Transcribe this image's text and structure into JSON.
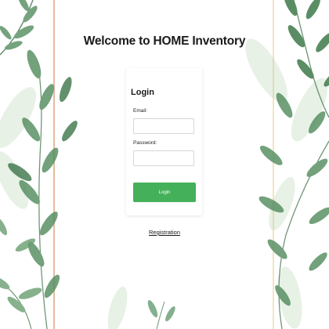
{
  "page": {
    "title": "Welcome to HOME Inventory"
  },
  "login_form": {
    "heading": "Login",
    "email_label": "Email:",
    "email_value": "",
    "password_label": "Password:",
    "password_value": "",
    "submit_label": "Login"
  },
  "footer": {
    "registration_link": "Registration"
  },
  "theme": {
    "accent_button": "#45b05a",
    "left_frame_line": "#e0a889",
    "right_frame_line": "#eed7a6",
    "leaf_dark": "#3f7a4a",
    "leaf_light": "#a9cba0"
  },
  "decor": {
    "background_icon": "watercolor-leaves-icon"
  }
}
